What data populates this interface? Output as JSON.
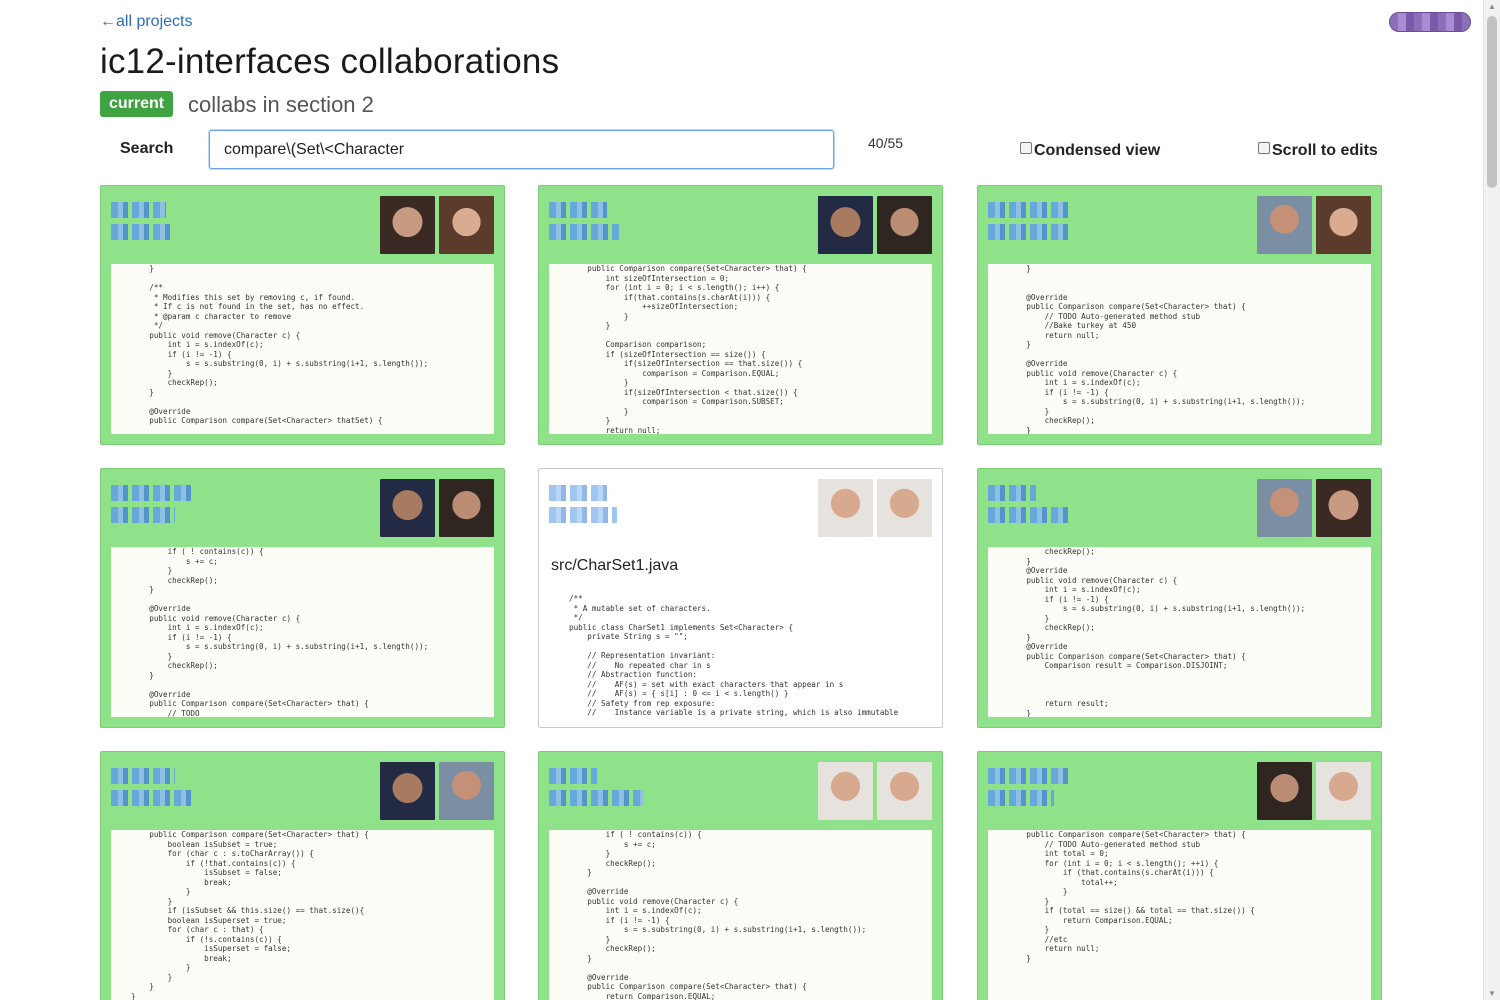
{
  "nav": {
    "back_link": "←all projects"
  },
  "header": {
    "title": "ic12-interfaces collaborations",
    "badge": "current",
    "subtitle": "collabs in section 2"
  },
  "controls": {
    "search_label": "Search",
    "search_value": "compare\\(Set\\<Character",
    "result_count": "40/55",
    "condensed_view_label": "Condensed view",
    "condensed_view_checked": false,
    "scroll_to_edits_label": "Scroll to edits",
    "scroll_to_edits_checked": false
  },
  "colors": {
    "card_match": "#8fe28a",
    "badge": "#3fa344",
    "link": "#2a6fb5"
  },
  "cards": [
    {
      "code": "    }\n\n    /**\n     * Modifies this set by removing c, if found.\n     * If c is not found in the set, has no effect.\n     * @param c character to remove\n     */\n    public void remove(Character c) {\n        int i = s.indexOf(c);\n        if (i != -1) {\n            s = s.substring(0, i) + s.substring(i+1, s.length());\n        }\n        checkRep();\n    }\n\n    @Override\n    public Comparison compare(Set<Character> thatSet) {\n\n    }\n}"
    },
    {
      "code": "    public Comparison compare(Set<Character> that) {\n        int sizeOfIntersection = 0;\n        for (int i = 0; i < s.length(); i++) {\n            if(that.contains(s.charAt(i))) {\n                ++sizeOfIntersection;\n            }\n        }\n\n        Comparison comparison;\n        if (sizeOfIntersection == size()) {\n            if(sizeOfIntersection == that.size()) {\n                comparison = Comparison.EQUAL;\n            }\n            if(sizeOfIntersection < that.size()) {\n                comparison = Comparison.SUBSET;\n            }\n        }\n        return null;"
    },
    {
      "code": "    }\n\n\n    @Override\n    public Comparison compare(Set<Character> that) {\n        // TODO Auto-generated method stub\n        //Bake turkey at 450\n        return null;\n    }\n\n    @Override\n    public void remove(Character c) {\n        int i = s.indexOf(c);\n        if (i != -1) {\n            s = s.substring(0, i) + s.substring(i+1, s.length());\n        }\n        checkRep();\n    }\n}"
    },
    {
      "code": "        if ( ! contains(c)) {\n            s += c;\n        }\n        checkRep();\n    }\n\n    @Override\n    public void remove(Character c) {\n        int i = s.indexOf(c);\n        if (i != -1) {\n            s = s.substring(0, i) + s.substring(i+1, s.length());\n        }\n        checkRep();\n    }\n\n    @Override\n    public Comparison compare(Set<Character> that) {\n        // TODO\n    }\n}"
    },
    {
      "file": "src/CharSet1.java",
      "code": "/**\n * A mutable set of characters.\n */\npublic class CharSet1 implements Set<Character> {\n    private String s = \"\";\n\n    // Representation invariant:\n    //    No repeated char in s\n    // Abstraction function:\n    //    AF(s) = set with exact characters that appear in s\n    //    AF(s) = { s[i] : 0 <= i < s.length() }\n    // Safety from rep exposure:\n    //    Instance variable is a private string, which is also immutable"
    },
    {
      "code": "        checkRep();\n    }\n    @Override\n    public void remove(Character c) {\n        int i = s.indexOf(c);\n        if (i != -1) {\n            s = s.substring(0, i) + s.substring(i+1, s.length());\n        }\n        checkRep();\n    }\n    @Override\n    public Comparison compare(Set<Character> that) {\n        Comparison result = Comparison.DISJOINT;\n\n\n\n        return result;\n    }\n}"
    },
    {
      "code": "    public Comparison compare(Set<Character> that) {\n        boolean isSubset = true;\n        for (char c : s.toCharArray()) {\n            if (!that.contains(c)) {\n                isSubset = false;\n                break;\n            }\n        }\n        if (isSubset && this.size() == that.size(){\n        boolean isSuperset = true;\n        for (char c : that) {\n            if (!s.contains(c)) {\n                isSuperset = false;\n                break;\n            }\n        }\n    }\n}"
    },
    {
      "code": "        if ( ! contains(c)) {\n            s += c;\n        }\n        checkRep();\n    }\n\n    @Override\n    public void remove(Character c) {\n        int i = s.indexOf(c);\n        if (i != -1) {\n            s = s.substring(0, i) + s.substring(i+1, s.length());\n        }\n        checkRep();\n    }\n\n    @Override\n    public Comparison compare(Set<Character> that) {\n        return Comparison.EQUAL;\n    }\n}"
    },
    {
      "code": "    public Comparison compare(Set<Character> that) {\n        // TODO Auto-generated method stub\n        int total = 0;\n        for (int i = 0; i < s.length(); ++i) {\n            if (that.contains(s.charAt(i))) {\n                total++;\n            }\n        }\n        if (total == size() && total == that.size()) {\n            return Comparison.EQUAL;\n        }\n        //etc\n        return null;\n    }"
    }
  ]
}
